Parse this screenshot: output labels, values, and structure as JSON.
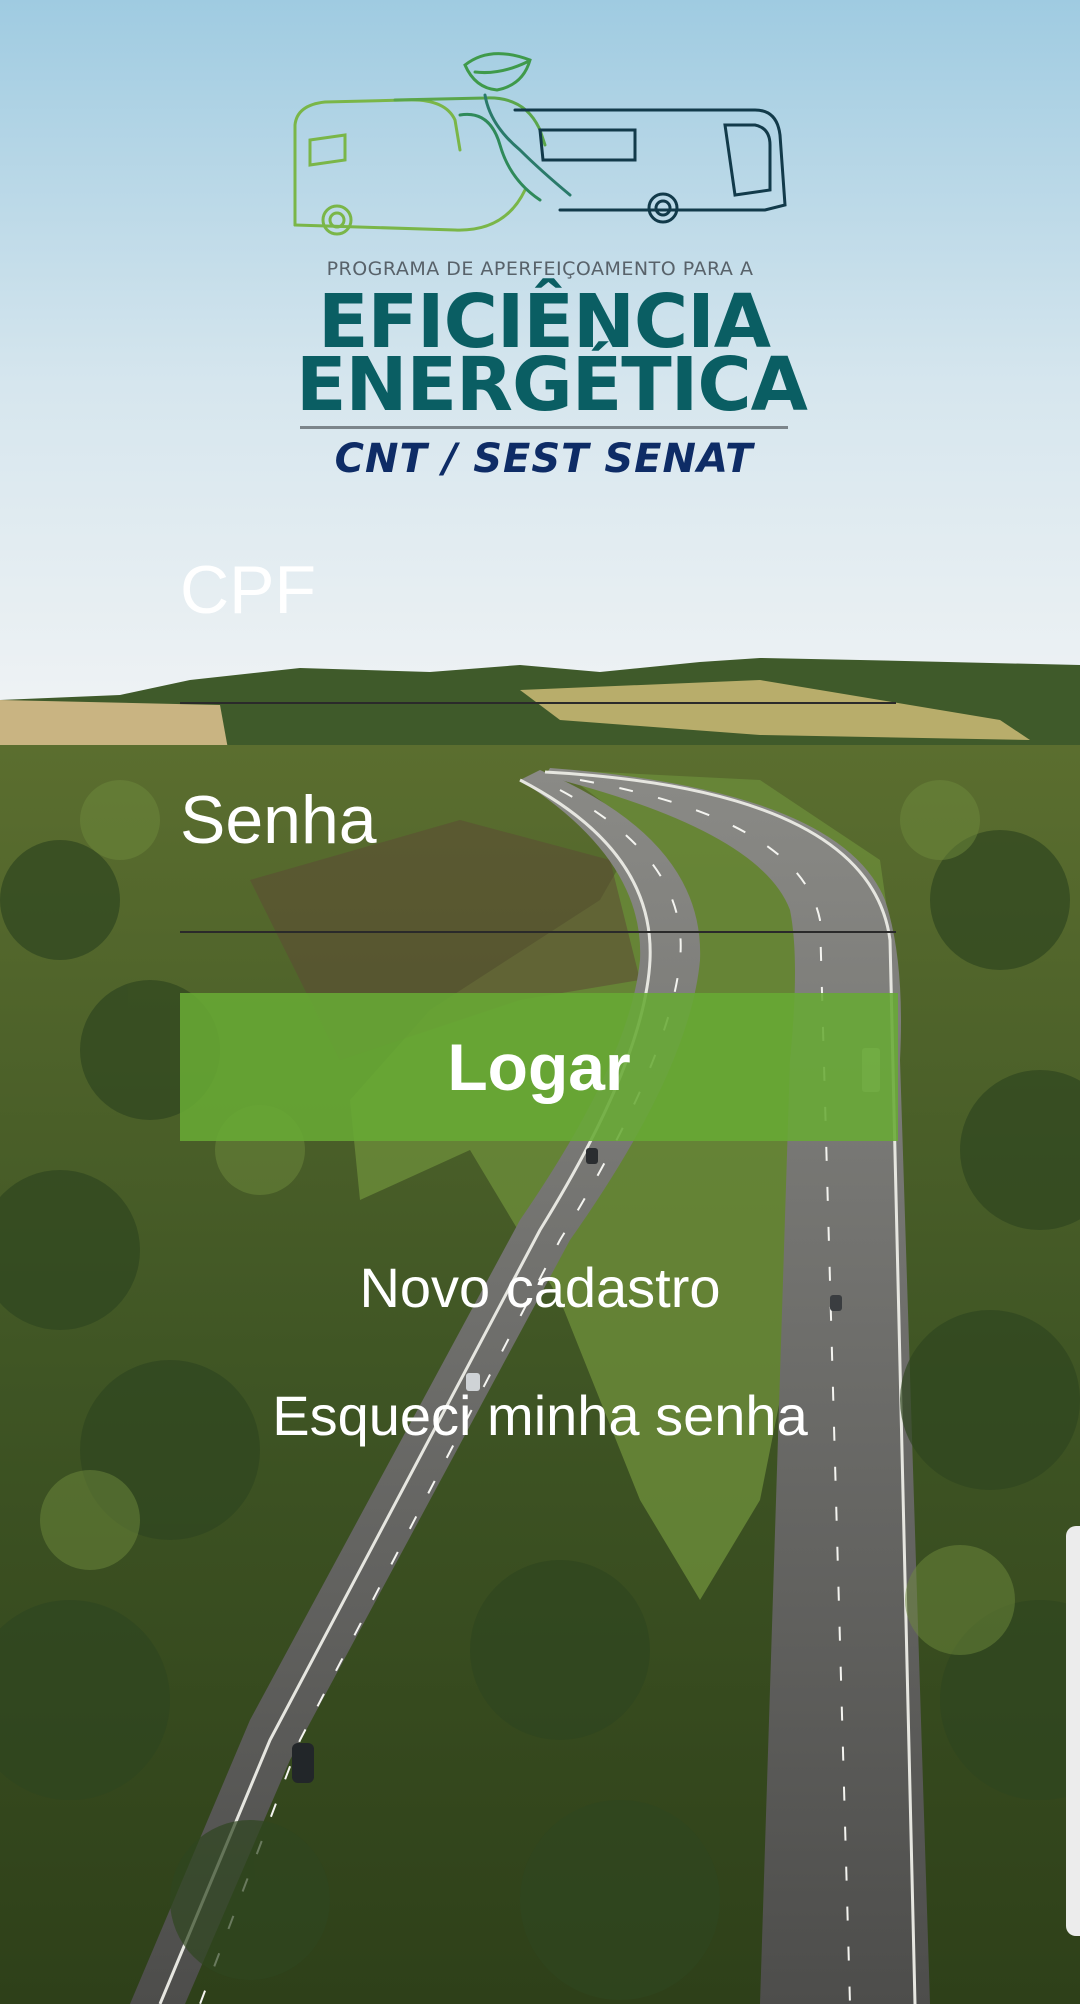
{
  "logo": {
    "subtitle": "PROGRAMA DE APERFEIÇOAMENTO PARA A",
    "line1": "EFICIÊNCIA",
    "line2": "ENERGÉTICA",
    "org": "CNT / SEST SENAT"
  },
  "form": {
    "cpf_label": "CPF",
    "password_label": "Senha",
    "login_button": "Logar"
  },
  "links": {
    "register": "Novo cadastro",
    "forgot_password": "Esqueci minha senha"
  },
  "colors": {
    "sky_top": "#9fcbe1",
    "button": "#68aa34",
    "logo_teal": "#0a5e63",
    "logo_navy": "#0e2c66"
  }
}
